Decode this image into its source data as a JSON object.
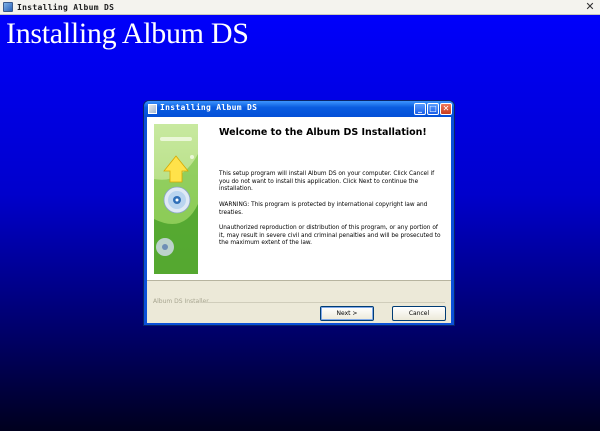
{
  "outer_window": {
    "title": "Installing Album DS",
    "close_glyph": "✕",
    "icon": "setup-app-icon"
  },
  "background": {
    "heading": "Installing Album DS",
    "gradient_colors": [
      "#0000ff",
      "#0000cc",
      "#000060",
      "#00001e"
    ]
  },
  "dialog": {
    "title": "Installing Album DS",
    "buttons": {
      "minimize": "_",
      "maximize": "□",
      "close": "✕"
    },
    "heading": "Welcome to the Album DS Installation!",
    "paragraphs": [
      "This setup program will install Album DS on your computer. Click Cancel if you do not want to install this application. Click Next to continue the installation.",
      "WARNING: This program is protected by international copyright law and treaties.",
      "Unauthorized reproduction or distribution of this program, or any portion of it, may result in severe civil and criminal penalties and will be prosecuted to the maximum extent of the law."
    ],
    "footer_label": "Album DS Installer",
    "next_button": "Next >",
    "cancel_button": "Cancel",
    "banner_icons": [
      "install-arrow-icon",
      "cd-disc-icon"
    ],
    "colors": {
      "titlebar": "#0a5ce0",
      "banner_green": "#b3dd7f",
      "arrow_yellow": "#ffe24a"
    }
  }
}
